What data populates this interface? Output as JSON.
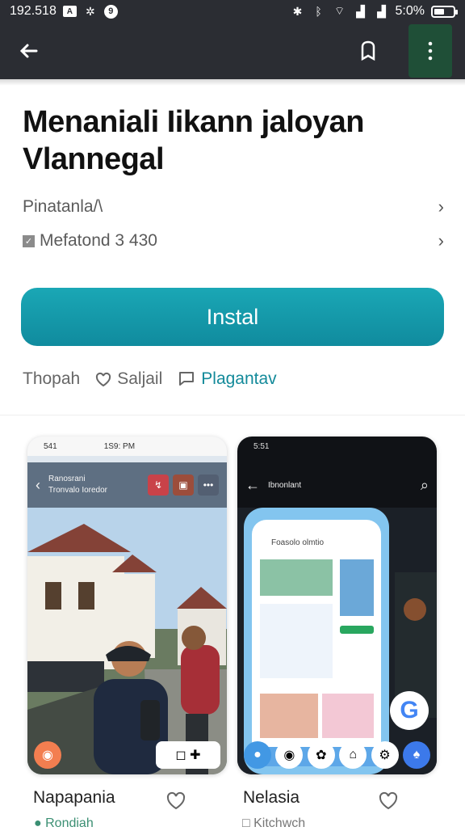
{
  "status": {
    "time": "192.518",
    "battery_percent": "5:0%",
    "battery_level": 0.55
  },
  "appbar": {
    "back_icon": "arrow-left-icon",
    "bookmark_icon": "bookmark-icon",
    "more_icon": "more-vertical-icon"
  },
  "app": {
    "title": "Menaniali Iikann jaloyan Vlannegal",
    "publisher": "Pinatanla/\\",
    "meta": "Mefatond 3 430",
    "install_label": "Instal"
  },
  "actions": [
    {
      "label": "Thopah",
      "icon": ""
    },
    {
      "label": "Saljail",
      "icon": "heart-icon"
    },
    {
      "label": "Plagantav",
      "icon": "chat-icon"
    }
  ],
  "screenshots": [
    {
      "status_time": "541",
      "status_center": "1S9: PM",
      "header_title": "Ranosrani",
      "header_subtitle": "Tronvalo Ioredor",
      "name": "Napapania"
    },
    {
      "status_time": "5:51",
      "header_title": "Ibnonlant",
      "inner_title": "Foasolo olmtio",
      "name": "Nelasia"
    }
  ],
  "bottom_partial": [
    "Rondiah",
    "Kitchwch"
  ]
}
